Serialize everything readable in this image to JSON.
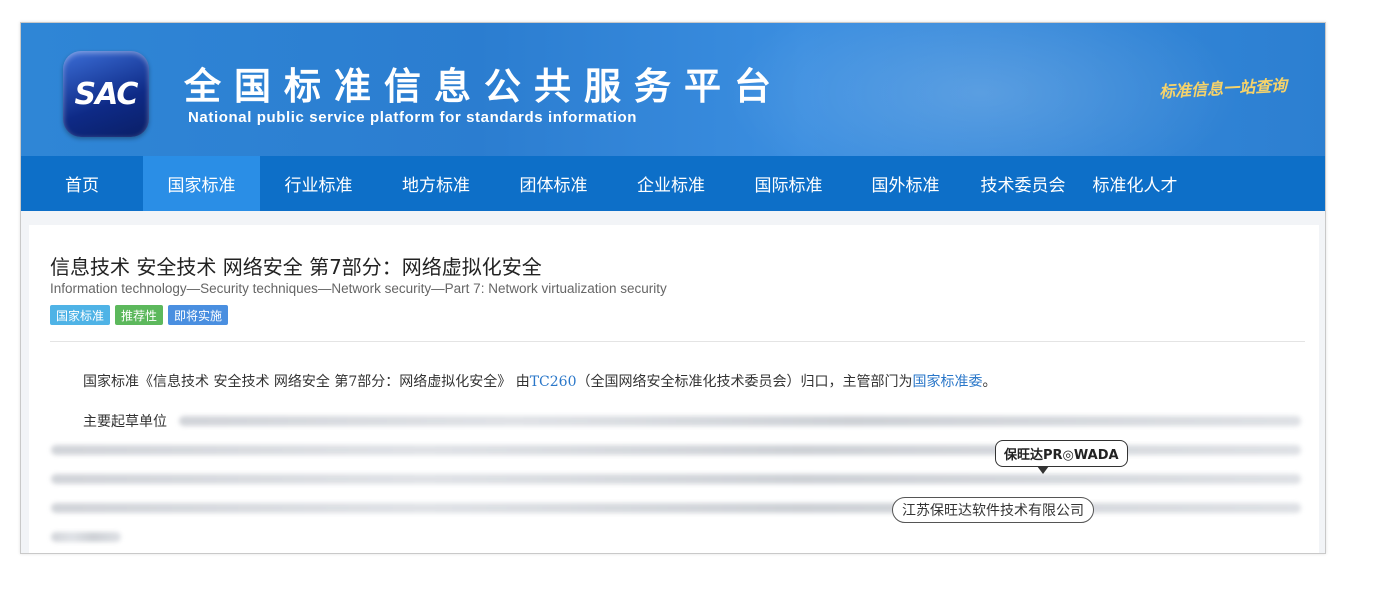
{
  "header": {
    "logo_text": "SAC",
    "title_cn": "全国标准信息公共服务平台",
    "title_en": "National public service platform  for standards information",
    "slogan": "标准信息一站查询"
  },
  "nav": {
    "items": [
      {
        "label": "首页",
        "active": false
      },
      {
        "label": "国家标准",
        "active": true
      },
      {
        "label": "行业标准",
        "active": false
      },
      {
        "label": "地方标准",
        "active": false
      },
      {
        "label": "团体标准",
        "active": false
      },
      {
        "label": "企业标准",
        "active": false
      },
      {
        "label": "国际标准",
        "active": false
      },
      {
        "label": "国外标准",
        "active": false
      },
      {
        "label": "技术委员会",
        "active": false
      },
      {
        "label": "标准化人才",
        "active": false
      }
    ]
  },
  "standard": {
    "title_cn": "信息技术 安全技术 网络安全 第7部分：网络虚拟化安全",
    "title_en": "Information technology—Security techniques—Network security—Part 7: Network virtualization security",
    "tags": [
      {
        "label": "国家标准",
        "color": "#4fb3e6"
      },
      {
        "label": "推荐性",
        "color": "#5cb85c"
      },
      {
        "label": "即将实施",
        "color": "#4a8fe0"
      }
    ],
    "intro_prefix": "国家标准《信息技术 安全技术 网络安全 第7部分：网络虚拟化安全》 由",
    "intro_committee_code": "TC260",
    "intro_middle": "（全国网络安全标准化技术委员会）归口，主管部门为",
    "intro_authority": "国家标准委",
    "intro_suffix": "。",
    "drafting_units_label": "主要起草单位"
  },
  "watermark": {
    "brand": "保旺达PR◎WADA",
    "company": "江苏保旺达软件技术有限公司"
  },
  "colors": {
    "banner": "#2b7dd0",
    "nav": "#0d6fc8",
    "nav_active": "#2a8ee6",
    "link": "#2a77c9"
  }
}
